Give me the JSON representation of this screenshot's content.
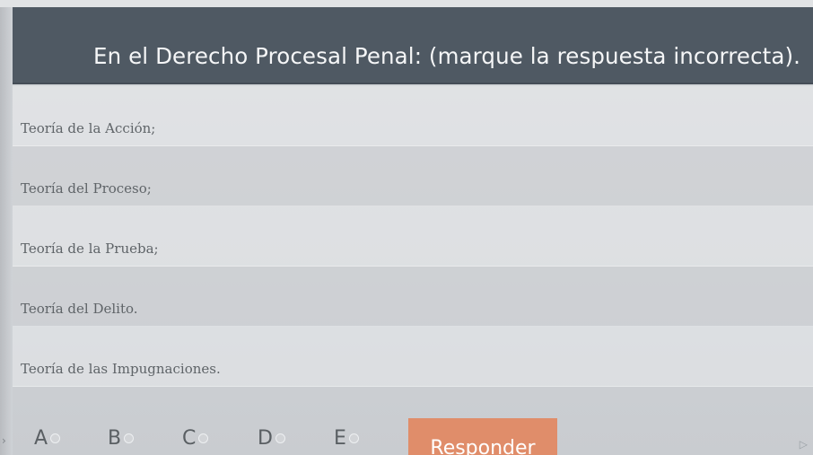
{
  "question": {
    "title": "En el Derecho Procesal Penal: (marque la respuesta incorrecta)."
  },
  "options": [
    {
      "text": "Teoría de la Acción;"
    },
    {
      "text": "Teoría del Proceso;"
    },
    {
      "text": "Teoría de la Prueba;"
    },
    {
      "text": "Teoría del Delito."
    },
    {
      "text": "Teoría de las Impugnaciones."
    }
  ],
  "choices": [
    {
      "letter": "A",
      "selected": false
    },
    {
      "letter": "B",
      "selected": false
    },
    {
      "letter": "C",
      "selected": false
    },
    {
      "letter": "D",
      "selected": false
    },
    {
      "letter": "E",
      "selected": false
    }
  ],
  "submit": {
    "label": "Responder"
  },
  "colors": {
    "header_bg": "#4f5963",
    "button_bg": "#e08d6a"
  },
  "icons": {
    "left_arrow": "chevron-right-icon",
    "corner": "play-icon"
  }
}
